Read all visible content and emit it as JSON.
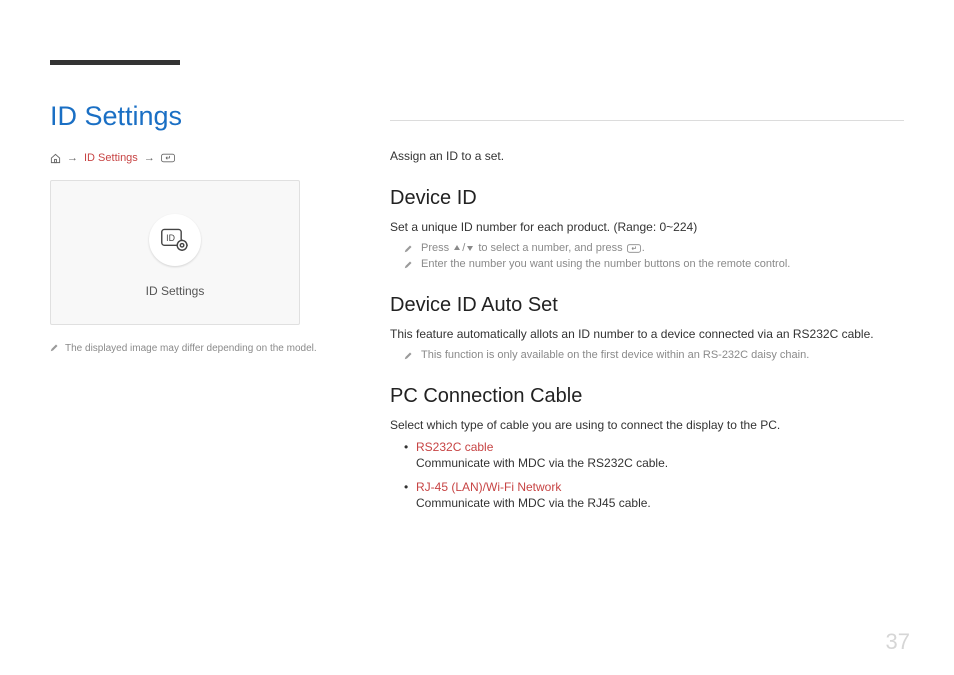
{
  "left": {
    "title": "ID Settings",
    "breadcrumb": {
      "arrow": "→",
      "link": "ID Settings"
    },
    "panel_label": "ID Settings",
    "note": "The displayed image may differ depending on the model."
  },
  "intro": "Assign an ID to a set.",
  "sections": {
    "device_id": {
      "heading": "Device ID",
      "desc": "Set a unique ID number for each product. (Range: 0~224)",
      "note1_a": "Press",
      "note1_b": "/",
      "note1_c": "to select a number, and press",
      "note1_d": ".",
      "note2": "Enter the number you want using the number buttons on the remote control."
    },
    "auto_set": {
      "heading": "Device ID Auto Set",
      "desc": "This feature automatically allots an ID number to a device connected via an RS232C cable.",
      "note": "This function is only available on the first device within an RS-232C daisy chain."
    },
    "cable": {
      "heading": "PC Connection Cable",
      "desc": "Select which type of cable you are using to connect the display to the PC.",
      "options": [
        {
          "name": "RS232C cable",
          "desc": "Communicate with MDC via the RS232C cable."
        },
        {
          "name": "RJ-45 (LAN)/Wi-Fi Network",
          "desc": "Communicate with MDC via the RJ45 cable."
        }
      ]
    }
  },
  "page_number": "37"
}
